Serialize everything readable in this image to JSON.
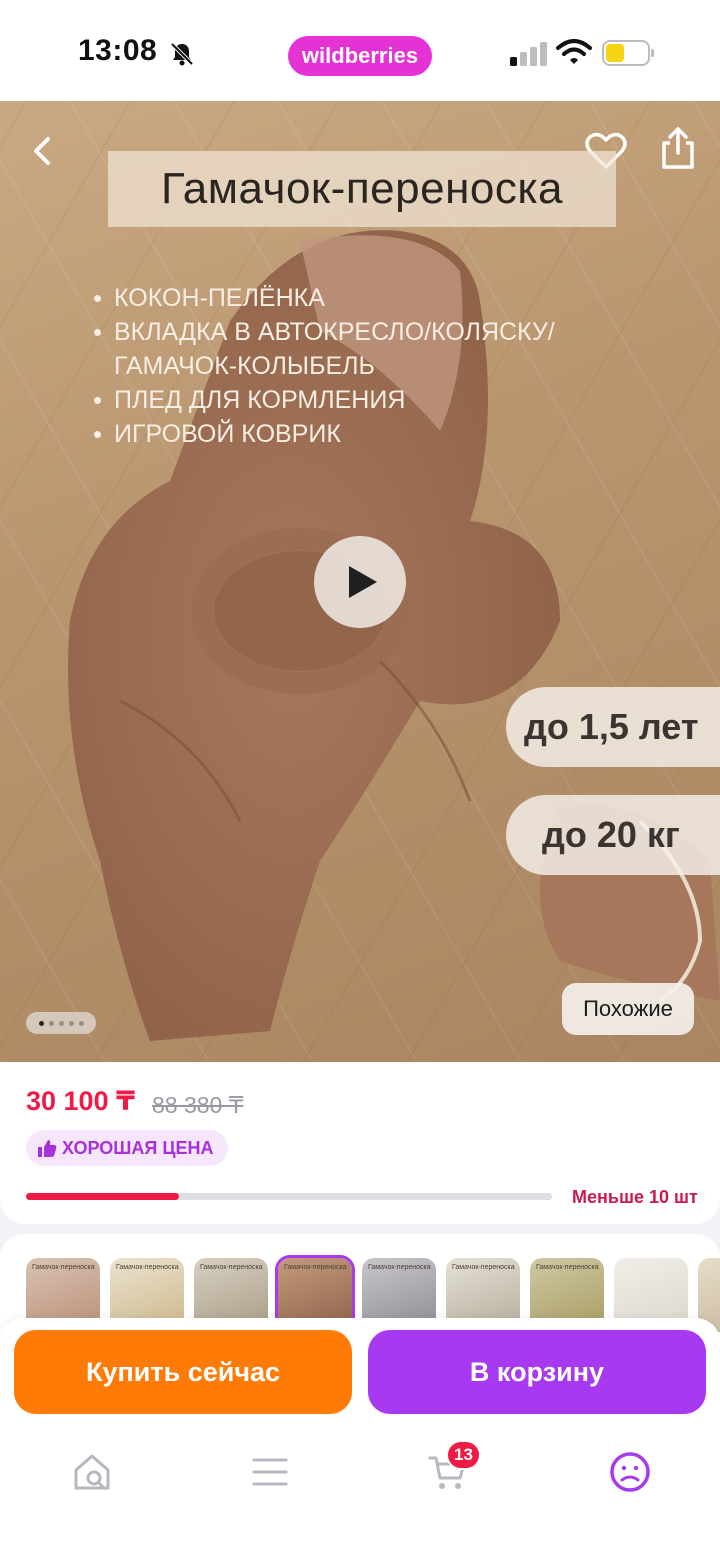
{
  "status_bar": {
    "time": "13:08",
    "brand": "wildberries",
    "icons": [
      "bell-off-icon",
      "cellular-signal-icon",
      "wifi-icon",
      "battery-icon"
    ]
  },
  "hero": {
    "title": "Гамачок-переноска",
    "features": [
      "КОКОН-ПЕЛЁНКА",
      "ВКЛАДКА В АВТОКРЕСЛО/КОЛЯСКУ/",
      "ГАМАЧОК-КОЛЫБЕЛЬ",
      "ПЛЕД ДЛЯ КОРМЛЕНИЯ",
      "ИГРОВОЙ КОВРИК"
    ],
    "age_label": "до 1,5 лет",
    "weight_label": "до 20 кг",
    "similar_button": "Похожие",
    "slide_count": 5,
    "active_slide": 1,
    "icons": [
      "back-arrow-icon",
      "heart-icon",
      "share-icon",
      "play-icon"
    ]
  },
  "price": {
    "current": "30 100 ₸",
    "old": "88 380 ₸",
    "badge": "ХОРОШАЯ ЦЕНА",
    "stock_text": "Меньше 10 шт",
    "stock_fraction": 0.29
  },
  "thumbnails": {
    "label": "Гамачок-переноска",
    "count": 9,
    "selected_index": 3
  },
  "actions": {
    "buy_now": "Купить сейчас",
    "add_to_cart": "В корзину"
  },
  "tab_bar": {
    "cart_count": "13",
    "icons": [
      "home-search-icon",
      "catalog-menu-icon",
      "cart-icon",
      "profile-icon"
    ]
  },
  "colors": {
    "brand": "#e532d4",
    "price_red": "#ef1b47",
    "buy_orange": "#ff7b08",
    "cart_purple": "#a73af0"
  }
}
